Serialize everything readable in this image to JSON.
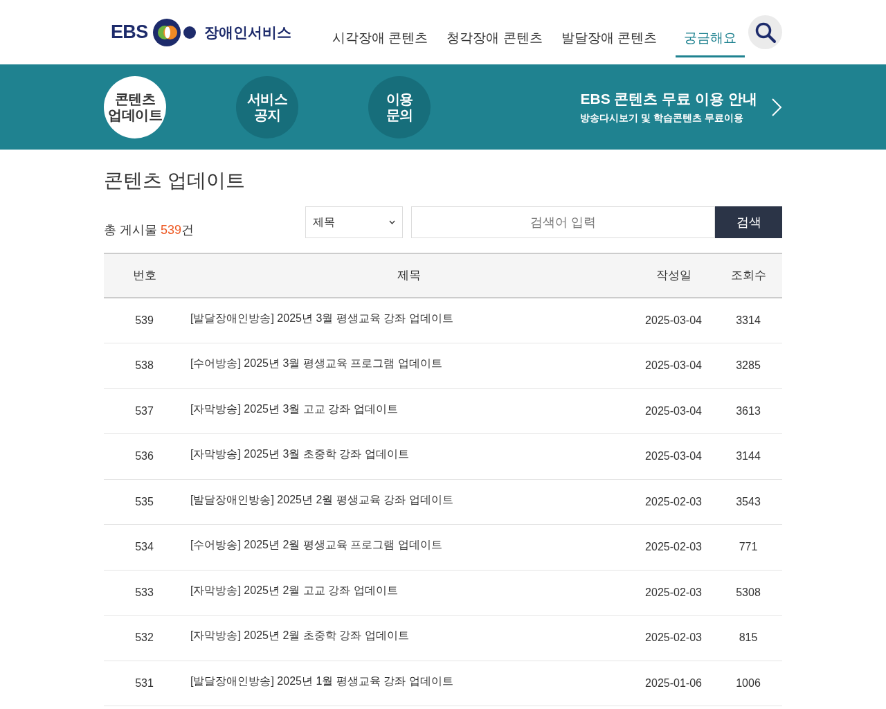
{
  "header": {
    "logo": {
      "brand": "EBS",
      "service": "장애인서비스"
    },
    "nav": [
      {
        "label": "시각장애 콘텐츠",
        "selected": false
      },
      {
        "label": "청각장애 콘텐츠",
        "selected": false
      },
      {
        "label": "발달장애 콘텐츠",
        "selected": false
      },
      {
        "label": "궁금해요",
        "selected": true
      }
    ]
  },
  "quick_menu": [
    {
      "lines": [
        "콘텐츠",
        "업데이트"
      ],
      "selected": true
    },
    {
      "lines": [
        "서비스",
        "공지"
      ],
      "selected": false
    },
    {
      "lines": [
        "이용",
        "문의"
      ],
      "selected": false
    }
  ],
  "banner": {
    "title": "EBS 콘텐츠 무료 이용 안내",
    "subtitle": "방송다시보기 및 학습콘텐츠 무료이용"
  },
  "page_title": "콘텐츠 업데이트",
  "total": {
    "prefix": "총 게시물",
    "count": "539",
    "suffix": "건"
  },
  "search": {
    "field": "제목",
    "placeholder": "검색어 입력",
    "button": "검색"
  },
  "table": {
    "columns": [
      "번호",
      "제목",
      "작성일",
      "조회수"
    ],
    "rows": [
      {
        "no": "539",
        "title": "[발달장애인방송] 2025년 3월 평생교육 강좌 업데이트",
        "date": "2025-03-04",
        "views": "3314"
      },
      {
        "no": "538",
        "title": "[수어방송] 2025년 3월 평생교육 프로그램 업데이트",
        "date": "2025-03-04",
        "views": "3285"
      },
      {
        "no": "537",
        "title": "[자막방송] 2025년 3월 고교 강좌 업데이트",
        "date": "2025-03-04",
        "views": "3613"
      },
      {
        "no": "536",
        "title": "[자막방송] 2025년 3월 초중학 강좌 업데이트",
        "date": "2025-03-04",
        "views": "3144"
      },
      {
        "no": "535",
        "title": "[발달장애인방송] 2025년 2월 평생교육 강좌 업데이트",
        "date": "2025-02-03",
        "views": "3543"
      },
      {
        "no": "534",
        "title": "[수어방송] 2025년 2월 평생교육 프로그램 업데이트",
        "date": "2025-02-03",
        "views": "771"
      },
      {
        "no": "533",
        "title": "[자막방송] 2025년 2월 고교 강좌 업데이트",
        "date": "2025-02-03",
        "views": "5308"
      },
      {
        "no": "532",
        "title": "[자막방송] 2025년 2월 초중학 강좌 업데이트",
        "date": "2025-02-03",
        "views": "815"
      },
      {
        "no": "531",
        "title": "[발달장애인방송] 2025년 1월 평생교육 강좌 업데이트",
        "date": "2025-01-06",
        "views": "1006"
      }
    ]
  }
}
